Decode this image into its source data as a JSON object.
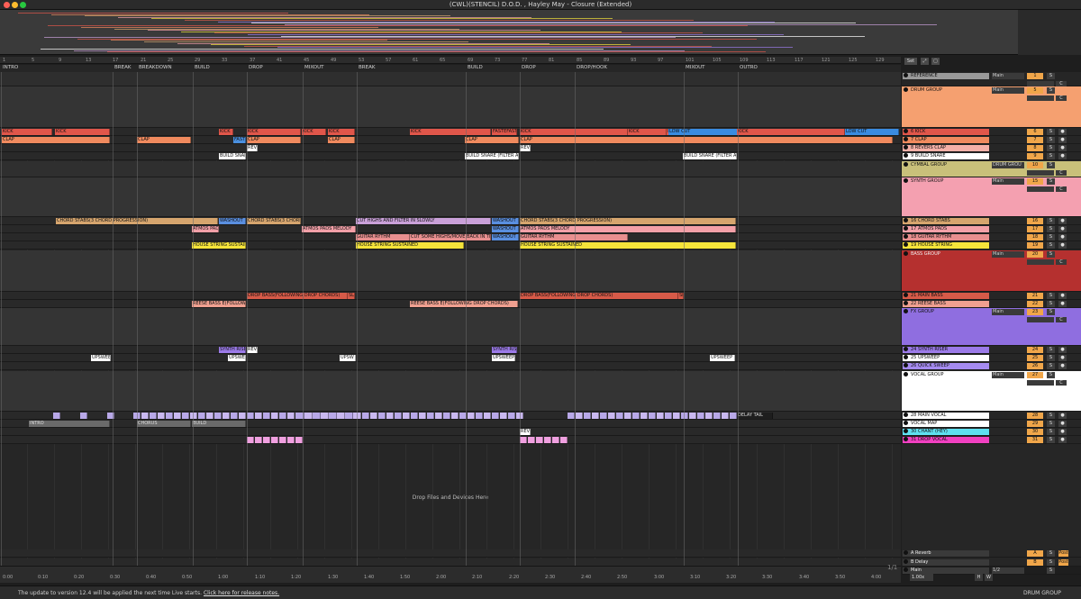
{
  "window": {
    "title": "(CWL)(STENCIL) D.O.D. , Hayley May - Closure (Extended)",
    "traffic_colors": [
      "#ff5f57",
      "#febc2e",
      "#28c840"
    ]
  },
  "top_controls": {
    "set_label": "Set",
    "btn2_label": "⤢",
    "btn3_label": "▢"
  },
  "bar_numbers": [
    "1",
    "5",
    "9",
    "13",
    "17",
    "21",
    "25",
    "29",
    "33",
    "37",
    "41",
    "45",
    "49",
    "53",
    "57",
    "61",
    "65",
    "69",
    "73",
    "77",
    "81",
    "85",
    "89",
    "93",
    "97",
    "101",
    "105",
    "109",
    "113",
    "117",
    "121",
    "125",
    "129"
  ],
  "locators": [
    {
      "label": "INTRO"
    },
    {
      "label": "BREAK"
    },
    {
      "label": "BREAKDOWN"
    },
    {
      "label": "BUILD"
    },
    {
      "label": "DROP"
    },
    {
      "label": "MIXOUT"
    },
    {
      "label": "BREAK"
    },
    {
      "label": "BUILD"
    },
    {
      "label": "DROP"
    },
    {
      "label": "DROP/HOOK"
    },
    {
      "label": "MIXOUT"
    },
    {
      "label": "OUTRO"
    }
  ],
  "time_labels": [
    "0:00",
    "0:10",
    "0:20",
    "0:30",
    "0:40",
    "0:50",
    "1:00",
    "1:10",
    "1:20",
    "1:30",
    "1:40",
    "1:50",
    "2:00",
    "2:10",
    "2:20",
    "2:30",
    "2:40",
    "2:50",
    "3:00",
    "3:10",
    "3:20",
    "3:30",
    "3:40",
    "3:50",
    "4:00"
  ],
  "page_indicator": "1/1",
  "drop_hint": "Drop Files and Devices Here",
  "tracks": [
    {
      "name": "REFERENCE",
      "color": "#9a9a9a",
      "routing": "Main",
      "num": "1",
      "s": "S",
      "arm": "",
      "group": false
    },
    {
      "name": "DRUM GROUP",
      "color": "#f5a070",
      "routing": "Main",
      "num": "5",
      "s": "S",
      "arm": "",
      "group": true
    },
    {
      "name": "6 KICK",
      "color": "#e0564a",
      "routing": "",
      "num": "6",
      "s": "S",
      "arm": "●",
      "group": false
    },
    {
      "name": "7 CLAP",
      "color": "#f08a5e",
      "routing": "",
      "num": "7",
      "s": "S",
      "arm": "●",
      "group": false
    },
    {
      "name": "8 REVERS CLAP",
      "color": "#f5b0a8",
      "routing": "",
      "num": "8",
      "s": "S",
      "arm": "●",
      "group": false
    },
    {
      "name": "9 BUILD SNARE",
      "color": "#ffffff",
      "routing": "",
      "num": "9",
      "s": "S",
      "arm": "●",
      "group": false
    },
    {
      "name": "CYMBAL GROUP",
      "color": "#c9c07a",
      "routing": "DRUM GROU",
      "num": "10",
      "s": "S",
      "arm": "",
      "group": true
    },
    {
      "name": "SYNTH GROUP",
      "color": "#f4a0b0",
      "routing": "Main",
      "num": "15",
      "s": "S",
      "arm": "",
      "group": true
    },
    {
      "name": "16 CHORD STABS",
      "color": "#d6a56e",
      "routing": "",
      "num": "16",
      "s": "S",
      "arm": "●",
      "group": false
    },
    {
      "name": "17 ATMOS PADS",
      "color": "#f3a0a8",
      "routing": "",
      "num": "17",
      "s": "S",
      "arm": "●",
      "group": false
    },
    {
      "name": "18 GUITAR RYTHM",
      "color": "#e88f8f",
      "routing": "",
      "num": "18",
      "s": "S",
      "arm": "●",
      "group": false
    },
    {
      "name": "19 HOUSE STRING",
      "color": "#f5e43a",
      "routing": "",
      "num": "19",
      "s": "S",
      "arm": "●",
      "group": false
    },
    {
      "name": "BASS GROUP",
      "color": "#b5302f",
      "routing": "Main",
      "num": "20",
      "s": "S",
      "arm": "",
      "group": true
    },
    {
      "name": "21 MAIN BASS",
      "color": "#d65a48",
      "routing": "",
      "num": "21",
      "s": "S",
      "arm": "●",
      "group": false
    },
    {
      "name": "22 REESE BASS",
      "color": "#f0a090",
      "routing": "",
      "num": "22",
      "s": "S",
      "arm": "●",
      "group": false
    },
    {
      "name": "FX GROUP",
      "color": "#8f6ee0",
      "routing": "Main",
      "num": "23",
      "s": "S",
      "arm": "",
      "group": true
    },
    {
      "name": "24 SYNTH RISER",
      "color": "#9b7ae8",
      "routing": "",
      "num": "24",
      "s": "S",
      "arm": "●",
      "group": false
    },
    {
      "name": "25 UPSWEEP",
      "color": "#ffffff",
      "routing": "",
      "num": "25",
      "s": "S",
      "arm": "●",
      "group": false
    },
    {
      "name": "26 QUICK SWEEP",
      "color": "#a58bf0",
      "routing": "",
      "num": "26",
      "s": "S",
      "arm": "●",
      "group": false
    },
    {
      "name": "VOCAL GROUP",
      "color": "#ffffff",
      "routing": "Main",
      "num": "27",
      "s": "S",
      "arm": "",
      "group": true
    },
    {
      "name": "28 MAIN VOCAL",
      "color": "#ffffff",
      "routing": "",
      "num": "28",
      "s": "S",
      "arm": "●",
      "group": false
    },
    {
      "name": "VOCAL MAP",
      "color": "#ffffff",
      "routing": "",
      "num": "29",
      "s": "S",
      "arm": "●",
      "group": false
    },
    {
      "name": "30 CHANT (HEY)",
      "color": "#5ee0f0",
      "routing": "",
      "num": "30",
      "s": "S",
      "arm": "●",
      "group": false
    },
    {
      "name": "31 DROP VOCAL",
      "color": "#f040c0",
      "routing": "",
      "num": "31",
      "s": "S",
      "arm": "●",
      "group": false
    },
    {
      "name": "A Reverb",
      "color": "#3a3a3a",
      "routing": "",
      "num": "A",
      "s": "S",
      "arm": "Post",
      "group": false
    },
    {
      "name": "B Delay",
      "color": "#3a3a3a",
      "routing": "",
      "num": "B",
      "s": "S",
      "arm": "Post",
      "group": false
    },
    {
      "name": "Main",
      "color": "#3a3a3a",
      "routing": "1/2",
      "num": "",
      "s": "S",
      "arm": "",
      "group": false
    }
  ],
  "clips": [
    {
      "label": "KICK",
      "color": "#e0564a"
    },
    {
      "label": "KICK",
      "color": "#e0564a"
    },
    {
      "label": "KICK",
      "color": "#e0564a"
    },
    {
      "label": "FAST",
      "color": "#4a90e0"
    },
    {
      "label": "KICK",
      "color": "#e0564a"
    },
    {
      "label": "KICK",
      "color": "#e0564a"
    },
    {
      "label": "KICK",
      "color": "#e0564a"
    },
    {
      "label": "KICK",
      "color": "#e0564a"
    },
    {
      "label": "FASTEFAST",
      "color": "#e0564a"
    },
    {
      "label": "KICK",
      "color": "#e0564a"
    },
    {
      "label": "KICK",
      "color": "#e0564a"
    },
    {
      "label": "KICK",
      "color": "#e0564a"
    },
    {
      "label": "LOW CUT",
      "color": "#3a8be0"
    },
    {
      "label": "KICK",
      "color": "#e0564a"
    },
    {
      "label": "LOW CUT",
      "color": "#3a8be0"
    },
    {
      "label": "CLAP",
      "color": "#f08a5e"
    },
    {
      "label": "CLAP",
      "color": "#f08a5e"
    },
    {
      "label": "CLAP",
      "color": "#f08a5e"
    },
    {
      "label": "CLAP",
      "color": "#f08a5e"
    },
    {
      "label": "CLAP",
      "color": "#f08a5e"
    },
    {
      "label": "CLAP",
      "color": "#f08a5e"
    },
    {
      "label": "REV",
      "color": "#ffffff"
    },
    {
      "label": "REV",
      "color": "#ffffff"
    },
    {
      "label": "BUILD SNAF",
      "color": "#ffffff"
    },
    {
      "label": "BUILD SNARE (FILTER AN",
      "color": "#ffffff"
    },
    {
      "label": "BUILD SNARE (FILTER AN",
      "color": "#ffffff"
    },
    {
      "label": "CHORD STABS(3 CHORD PROGRESSION)",
      "color": "#d6a56e"
    },
    {
      "label": "WASHOUT",
      "color": "#5a8fe0"
    },
    {
      "label": "CHORD STABS(3 CHORD",
      "color": "#d6a56e"
    },
    {
      "label": "CUT HIGHS AND FILTER IN SLOWLY",
      "color": "#c9a0d8"
    },
    {
      "label": "WASHOUT",
      "color": "#5a8fe0"
    },
    {
      "label": "CHORD STABS(3 CHORD PROGRESSION)",
      "color": "#d6a56e"
    },
    {
      "label": "ATMOS PADS",
      "color": "#f3a0a8"
    },
    {
      "label": "ATMOS PADS MELODY",
      "color": "#f3a0a8"
    },
    {
      "label": "WASHOUT",
      "color": "#5a8fe0"
    },
    {
      "label": "ATMOS PADS MELODY",
      "color": "#f3a0a8"
    },
    {
      "label": "GUITAR RYTHM",
      "color": "#e88f8f"
    },
    {
      "label": "CUT SOME HIGHS/MOVE BACK IN THE",
      "color": "#e88f8f"
    },
    {
      "label": "WASHOUT",
      "color": "#5a8fe0"
    },
    {
      "label": "GUITAR RYTHM",
      "color": "#e88f8f"
    },
    {
      "label": "HOUSE STRING SUSTAIN",
      "color": "#f5e43a"
    },
    {
      "label": "HOUSE STRING SUSTAINED",
      "color": "#f5e43a"
    },
    {
      "label": "HOUSE STRING SUSTAINED",
      "color": "#f5e43a"
    },
    {
      "label": "DROP BASS(FOLLOWING DROP CHORDS)",
      "color": "#d65a48"
    },
    {
      "label": "SL",
      "color": "#d65a48"
    },
    {
      "label": "DROP BASS(FOLLOWING DROP CHORDS)",
      "color": "#d65a48"
    },
    {
      "label": "SL",
      "color": "#d65a48"
    },
    {
      "label": "REESE BASS E(FOLLOWI",
      "color": "#f0a090"
    },
    {
      "label": "REESE BASS E(FOLLOWING DROP CHORDS)",
      "color": "#f0a090"
    },
    {
      "label": "SYNTH RISE",
      "color": "#9b7ae8"
    },
    {
      "label": "REVE",
      "color": "#ffffff"
    },
    {
      "label": "SYNTH RISI",
      "color": "#9b7ae8"
    },
    {
      "label": "UPSWEE",
      "color": "#ffffff"
    },
    {
      "label": "UPSWEE",
      "color": "#ffffff"
    },
    {
      "label": "UPSW",
      "color": "#ffffff"
    },
    {
      "label": "UPSWEEP",
      "color": "#ffffff"
    },
    {
      "label": "UPSWEEP",
      "color": "#ffffff"
    },
    {
      "label": "DELAY TAIL",
      "color": "#1e1e1e"
    },
    {
      "label": "INTRO",
      "color": "#6a6a6a"
    },
    {
      "label": "CHORUS",
      "color": "#6a6a6a"
    },
    {
      "label": "BUILD",
      "color": "#6a6a6a"
    },
    {
      "label": "REVE",
      "color": "#ffffff"
    }
  ],
  "status": {
    "message": "The update to version 12.4 will be applied the next time Live starts.",
    "link": "Click here for release notes.",
    "selected_track": "DRUM GROUP",
    "tempo": "1.00x",
    "h": "H",
    "w": "W"
  }
}
